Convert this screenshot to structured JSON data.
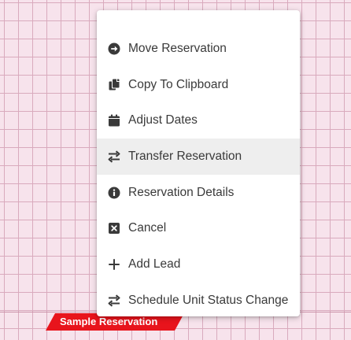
{
  "colors": {
    "grid_background": "#f7e3ec",
    "grid_lines": "#d9aabd",
    "reservation_bar": "#e8141c",
    "menu_text": "#3a3a3a",
    "menu_highlight": "#eeeeee"
  },
  "reservation": {
    "label": "Sample Reservation"
  },
  "context_menu": {
    "highlighted_index": 3,
    "items": [
      {
        "label": "Move Reservation",
        "icon": "arrow-circle-right-icon"
      },
      {
        "label": "Copy To Clipboard",
        "icon": "copy-icon"
      },
      {
        "label": "Adjust Dates",
        "icon": "calendar-icon"
      },
      {
        "label": "Transfer Reservation",
        "icon": "exchange-icon"
      },
      {
        "label": "Reservation Details",
        "icon": "info-circle-icon"
      },
      {
        "label": "Cancel",
        "icon": "close-box-icon"
      },
      {
        "label": "Add Lead",
        "icon": "plus-icon"
      },
      {
        "label": "Schedule Unit Status Change",
        "icon": "exchange-icon"
      }
    ]
  }
}
